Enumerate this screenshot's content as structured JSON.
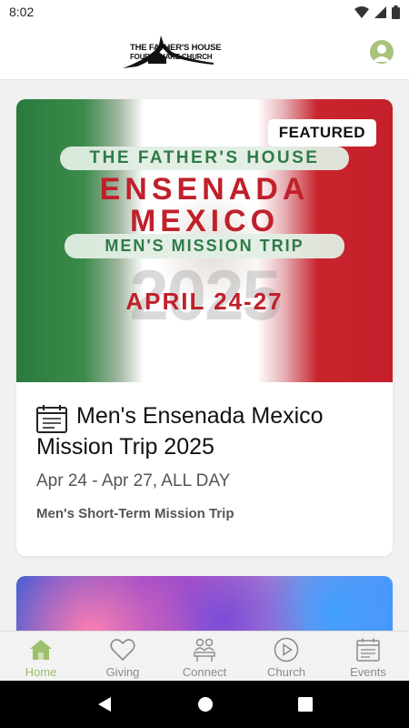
{
  "status_bar": {
    "time": "8:02"
  },
  "header": {
    "logo_line1": "THE FATHER'S HOUSE",
    "logo_line2": "FOURSQUARE CHURCH"
  },
  "featured_event": {
    "badge": "FEATURED",
    "banner": {
      "org": "THE FATHER'S HOUSE",
      "headline_1": "ENSENADA",
      "headline_2": "MEXICO",
      "subhead": "MEN'S MISSION TRIP",
      "year": "2025",
      "dates": "APRIL 24-27"
    },
    "title": "Men's Ensenada Mexico Mission Trip 2025",
    "date_range": "Apr 24 - Apr 27, ALL DAY",
    "subtitle": "Men's Short-Term Mission Trip"
  },
  "bottom_nav": {
    "items": [
      {
        "label": "Home",
        "icon": "home-icon",
        "active": true
      },
      {
        "label": "Giving",
        "icon": "heart-icon",
        "active": false
      },
      {
        "label": "Connect",
        "icon": "people-icon",
        "active": false
      },
      {
        "label": "Church",
        "icon": "play-icon",
        "active": false
      },
      {
        "label": "Events",
        "icon": "calendar-icon",
        "active": false
      }
    ]
  },
  "colors": {
    "accent": "#9dbf6c",
    "mexico_green": "#2a7a3e",
    "mexico_red": "#c41f2a"
  }
}
